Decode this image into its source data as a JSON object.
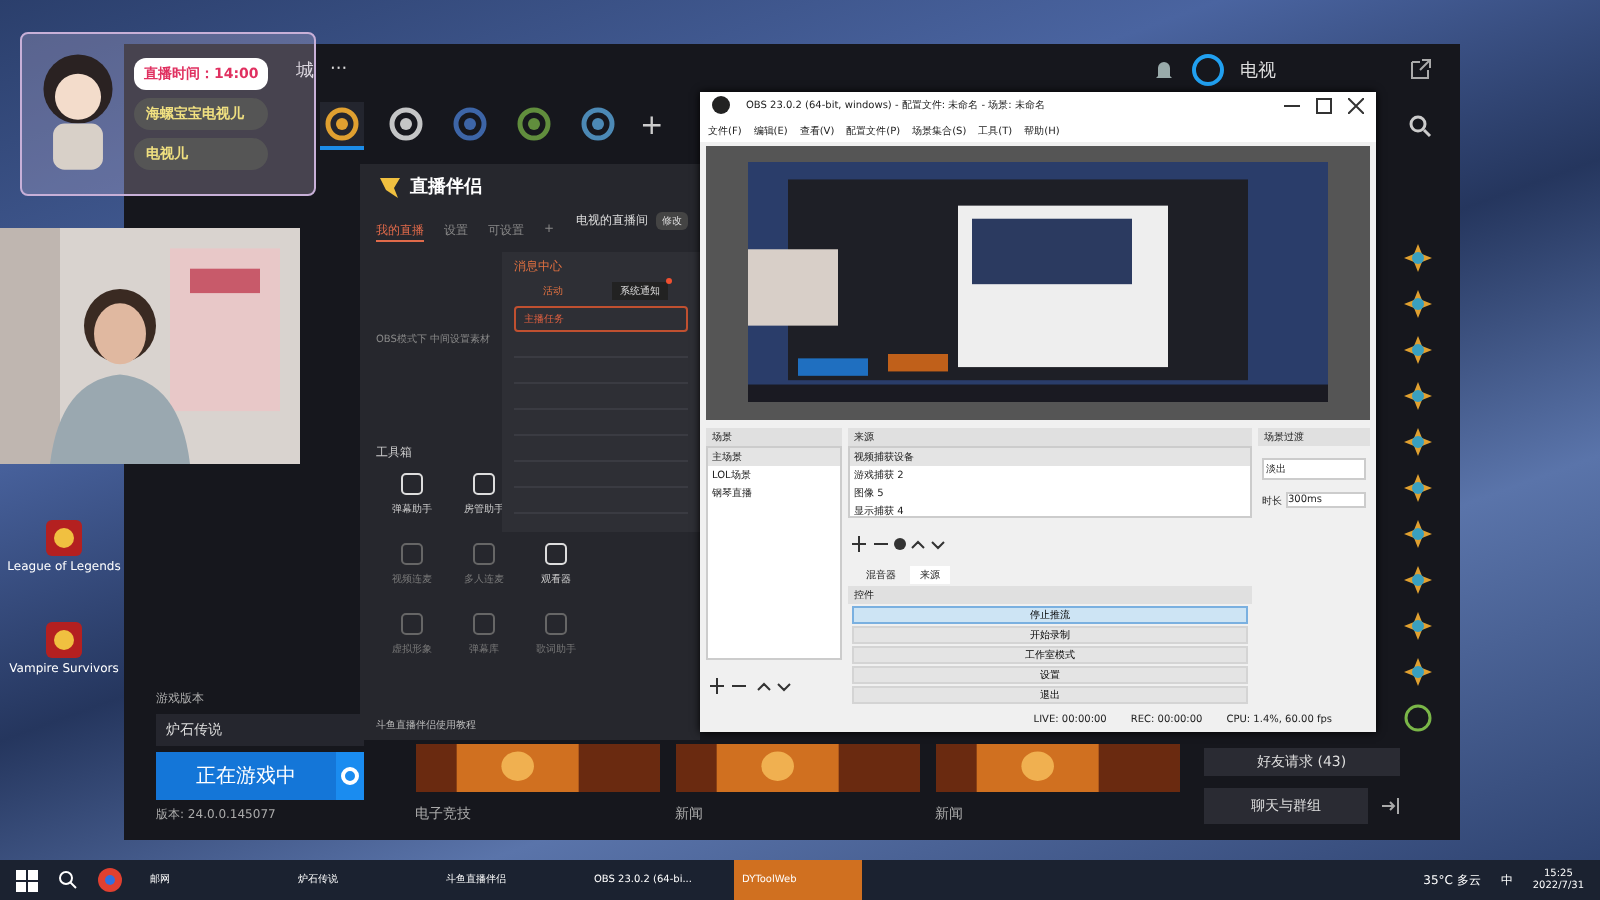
{
  "desktop_icons": [
    {
      "label": "League of Legends"
    },
    {
      "label": "Vampire Survivors"
    }
  ],
  "overlay": {
    "timer": "直播时间：14:00",
    "lines": [
      "海螺宝宝电视儿",
      "电视儿"
    ]
  },
  "launcher": {
    "menu_partial": "城",
    "more": "···",
    "user": "电视",
    "game_tabs": [
      {
        "kind": "hearth",
        "selected": true
      },
      {
        "kind": "ow",
        "selected": false
      },
      {
        "kind": "sc",
        "selected": false
      },
      {
        "kind": "classic",
        "selected": false
      },
      {
        "kind": "hots",
        "selected": false
      }
    ],
    "add_tab": "+",
    "version_label": "游戏版本",
    "game_field": "炉石传说",
    "play_button": "正在游戏中",
    "version": "版本: 24.0.0.145077",
    "news": [
      {
        "title": "电子竞技"
      },
      {
        "title": "新闻"
      },
      {
        "title": "新闻"
      }
    ],
    "friend_requests": "好友请求 (43)",
    "chat_button": "聊天与群组"
  },
  "companion": {
    "logo": "直播伴侣",
    "tabs": [
      {
        "label": "我的直播",
        "selected": true
      },
      {
        "label": "设置",
        "selected": false
      },
      {
        "label": "可设置",
        "selected": false
      }
    ],
    "add": "+",
    "room": "电视的直播间",
    "edit": "修改",
    "hint": "OBS模式下 中间设置素材",
    "toolbox_title": "工具箱",
    "tool_rows": [
      [
        {
          "label": "弹幕助手",
          "enabled": true
        },
        {
          "label": "房管助手",
          "enabled": true
        }
      ],
      [
        {
          "label": "视频连麦",
          "enabled": false
        },
        {
          "label": "多人连麦",
          "enabled": false
        },
        {
          "label": "观看器",
          "enabled": true
        }
      ],
      [
        {
          "label": "虚拟形象",
          "enabled": false
        },
        {
          "label": "弹幕库",
          "enabled": false
        },
        {
          "label": "歌词助手",
          "enabled": false
        }
      ]
    ],
    "footer": "斗鱼直播伴侣使用教程",
    "messages": {
      "title": "消息中心",
      "tabs": [
        {
          "label": "活动",
          "selected": false,
          "badge": false
        },
        {
          "label": "系统通知",
          "selected": true,
          "badge": true
        }
      ],
      "task": "主播任务"
    }
  },
  "obs": {
    "title": "OBS 23.0.2 (64-bit, windows) - 配置文件: 未命名 - 场景: 未命名",
    "menu": [
      "文件(F)",
      "编辑(E)",
      "查看(V)",
      "配置文件(P)",
      "场景集合(S)",
      "工具(T)",
      "帮助(H)"
    ],
    "scenes": {
      "title": "场景",
      "items": [
        {
          "label": "主场景",
          "selected": true
        },
        {
          "label": "LOL场景",
          "selected": false
        },
        {
          "label": "钢琴直播",
          "selected": false
        }
      ]
    },
    "sources": {
      "title": "来源",
      "items": [
        {
          "label": "视频捕获设备",
          "selected": true
        },
        {
          "label": "游戏捕获 2",
          "selected": false
        },
        {
          "label": "图像 5",
          "selected": false
        },
        {
          "label": "显示捕获 4",
          "selected": false
        }
      ]
    },
    "dock_tabs": [
      {
        "label": "混音器",
        "selected": false
      },
      {
        "label": "来源",
        "selected": true
      }
    ],
    "controls": {
      "title": "控件",
      "buttons": [
        {
          "label": "停止推流",
          "selected": true
        },
        {
          "label": "开始录制",
          "selected": false
        },
        {
          "label": "工作室模式",
          "selected": false
        },
        {
          "label": "设置",
          "selected": false
        },
        {
          "label": "退出",
          "selected": false
        }
      ]
    },
    "transitions": {
      "title": "场景过渡",
      "type": "淡出",
      "duration_label": "时长",
      "duration": "300ms"
    },
    "status": [
      "LIVE: 00:00:00",
      "REC: 00:00:00",
      "CPU: 1.4%, 60.00 fps"
    ]
  },
  "taskbar": {
    "items": [
      {
        "label": "邮网",
        "active": false
      },
      {
        "label": "炉石传说",
        "active": false
      },
      {
        "label": "斗鱼直播伴侣",
        "active": false
      },
      {
        "label": "OBS 23.0.2 (64-bi...",
        "active": false
      },
      {
        "label": "DYToolWeb",
        "active": true
      }
    ],
    "weather": "35°C 多云",
    "ime": "中",
    "time": "15:25",
    "date": "2022/7/31"
  }
}
